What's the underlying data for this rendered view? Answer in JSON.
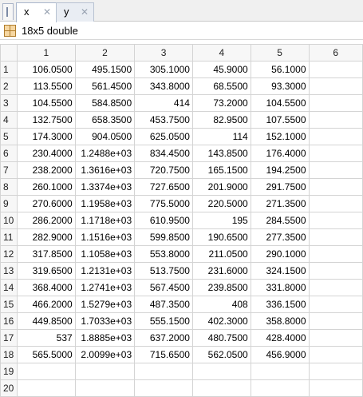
{
  "tabs": [
    {
      "label": "x",
      "active": true
    },
    {
      "label": "y",
      "active": false
    }
  ],
  "variable": {
    "size_label": "18x5 double"
  },
  "columns": [
    "1",
    "2",
    "3",
    "4",
    "5",
    "6"
  ],
  "rows": [
    {
      "label": "1",
      "cells": [
        "106.0500",
        "495.1500",
        "305.1000",
        "45.9000",
        "56.1000",
        ""
      ]
    },
    {
      "label": "2",
      "cells": [
        "113.5500",
        "561.4500",
        "343.8000",
        "68.5500",
        "93.3000",
        ""
      ]
    },
    {
      "label": "3",
      "cells": [
        "104.5500",
        "584.8500",
        "414",
        "73.2000",
        "104.5500",
        ""
      ]
    },
    {
      "label": "4",
      "cells": [
        "132.7500",
        "658.3500",
        "453.7500",
        "82.9500",
        "107.5500",
        ""
      ]
    },
    {
      "label": "5",
      "cells": [
        "174.3000",
        "904.0500",
        "625.0500",
        "114",
        "152.1000",
        ""
      ]
    },
    {
      "label": "6",
      "cells": [
        "230.4000",
        "1.2488e+03",
        "834.4500",
        "143.8500",
        "176.4000",
        ""
      ]
    },
    {
      "label": "7",
      "cells": [
        "238.2000",
        "1.3616e+03",
        "720.7500",
        "165.1500",
        "194.2500",
        ""
      ]
    },
    {
      "label": "8",
      "cells": [
        "260.1000",
        "1.3374e+03",
        "727.6500",
        "201.9000",
        "291.7500",
        ""
      ]
    },
    {
      "label": "9",
      "cells": [
        "270.6000",
        "1.1958e+03",
        "775.5000",
        "220.5000",
        "271.3500",
        ""
      ]
    },
    {
      "label": "10",
      "cells": [
        "286.2000",
        "1.1718e+03",
        "610.9500",
        "195",
        "284.5500",
        ""
      ]
    },
    {
      "label": "11",
      "cells": [
        "282.9000",
        "1.1516e+03",
        "599.8500",
        "190.6500",
        "277.3500",
        ""
      ]
    },
    {
      "label": "12",
      "cells": [
        "317.8500",
        "1.1058e+03",
        "553.8000",
        "211.0500",
        "290.1000",
        ""
      ]
    },
    {
      "label": "13",
      "cells": [
        "319.6500",
        "1.2131e+03",
        "513.7500",
        "231.6000",
        "324.1500",
        ""
      ]
    },
    {
      "label": "14",
      "cells": [
        "368.4000",
        "1.2741e+03",
        "567.4500",
        "239.8500",
        "331.8000",
        ""
      ]
    },
    {
      "label": "15",
      "cells": [
        "466.2000",
        "1.5279e+03",
        "487.3500",
        "408",
        "336.1500",
        ""
      ]
    },
    {
      "label": "16",
      "cells": [
        "449.8500",
        "1.7033e+03",
        "555.1500",
        "402.3000",
        "358.8000",
        ""
      ]
    },
    {
      "label": "17",
      "cells": [
        "537",
        "1.8885e+03",
        "637.2000",
        "480.7500",
        "428.4000",
        ""
      ]
    },
    {
      "label": "18",
      "cells": [
        "565.5000",
        "2.0099e+03",
        "715.6500",
        "562.0500",
        "456.9000",
        ""
      ]
    },
    {
      "label": "19",
      "cells": [
        "",
        "",
        "",
        "",
        "",
        ""
      ]
    },
    {
      "label": "20",
      "cells": [
        "",
        "",
        "",
        "",
        "",
        ""
      ]
    }
  ]
}
